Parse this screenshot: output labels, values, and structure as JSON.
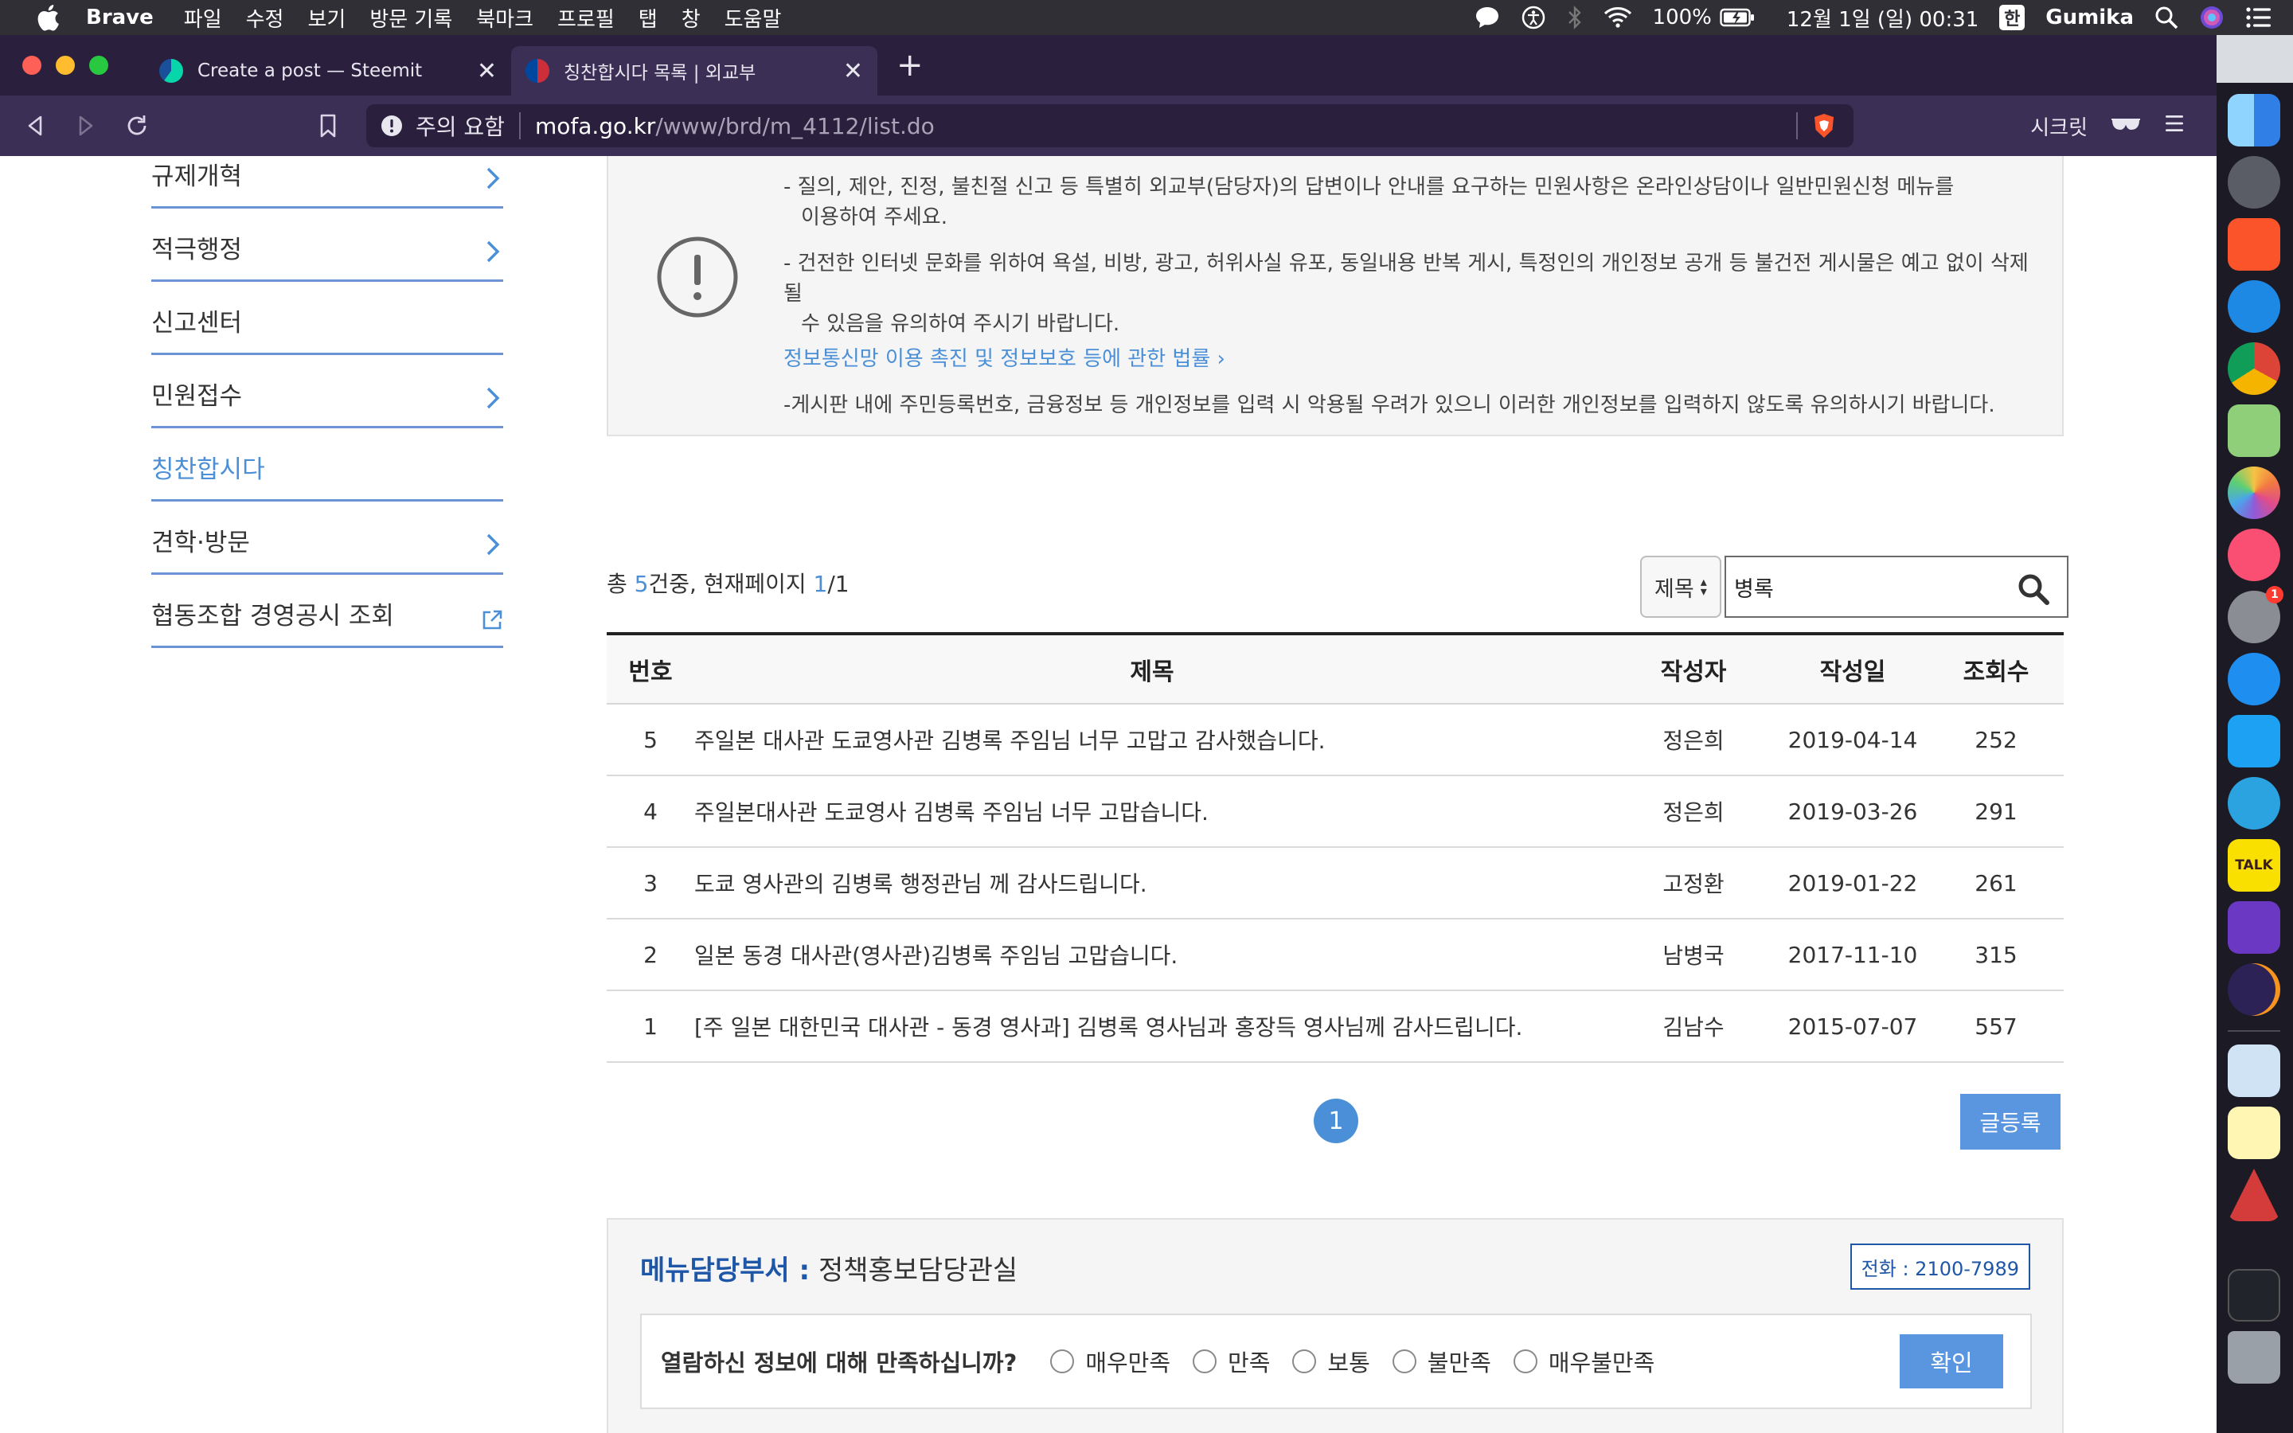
{
  "menubar": {
    "app_name": "Brave",
    "items": [
      "파일",
      "수정",
      "보기",
      "방문 기록",
      "북마크",
      "프로필",
      "탭",
      "창",
      "도움말"
    ],
    "battery": "100%",
    "datetime": "12월 1일 (일)  00:31",
    "input_method": "한",
    "user": "Gumika"
  },
  "browser": {
    "tabs": [
      {
        "title": "Create a post — Steemit",
        "close": "✕"
      },
      {
        "title": "칭찬합시다 목록 | 외교부",
        "close": "✕"
      }
    ],
    "new_tab": "+",
    "security_label": "주의 요함",
    "url_host": "mofa.go.kr",
    "url_path": "/www/brd/m_4112/list.do",
    "private_label": "시크릿"
  },
  "sidebar": {
    "items": [
      {
        "label": "규제개혁"
      },
      {
        "label": "적극행정"
      },
      {
        "label": "신고센터"
      },
      {
        "label": "민원접수"
      },
      {
        "label": "칭찬합시다"
      },
      {
        "label": "견학·방문"
      },
      {
        "label": "협동조합 경영공시 조회"
      }
    ]
  },
  "notice": {
    "line1a": "- 질의, 제안, 진정, 불친절 신고 등 특별히 외교부(담당자)의 답변이나 안내를 요구하는 민원사항은 온라인상담이나 일반민원신청 메뉴를",
    "line1b": "이용하여 주세요.",
    "line2a": "- 건전한 인터넷 문화를 위하여 욕설, 비방, 광고, 허위사실 유포, 동일내용 반복 게시, 특정인의 개인정보 공개 등 불건전 게시물은 예고 없이 삭제될",
    "line2b": "수 있음을 유의하여 주시기 바랍니다.",
    "link": "정보통신망 이용 촉진 및 정보보호 등에 관한 법률 ›",
    "line3": "-게시판 내에 주민등록번호, 금융정보 등 개인정보를 입력 시 악용될 우려가 있으니 이러한 개인정보를 입력하지 않도록 유의하시기 바랍니다."
  },
  "count": {
    "prefix": "총 ",
    "total": "5",
    "middle": "건중, 현재페이지 ",
    "page": "1",
    "suffix": "/1"
  },
  "search": {
    "field": "제목",
    "value": "병록"
  },
  "table": {
    "headers": [
      "번호",
      "제목",
      "작성자",
      "작성일",
      "조회수"
    ],
    "rows": [
      {
        "no": "5",
        "title": "주일본 대사관 도쿄영사관 김병록 주임님 너무 고맙고 감사했습니다.",
        "author": "정은희",
        "date": "2019-04-14",
        "views": "252"
      },
      {
        "no": "4",
        "title": "주일본대사관 도쿄영사 김병록 주임님 너무 고맙습니다.",
        "author": "정은희",
        "date": "2019-03-26",
        "views": "291"
      },
      {
        "no": "3",
        "title": "도쿄 영사관의 김병록 행정관님 께 감사드립니다.",
        "author": "고정환",
        "date": "2019-01-22",
        "views": "261"
      },
      {
        "no": "2",
        "title": "일본 동경 대사관(영사관)김병록 주임님 고맙습니다.",
        "author": "남병국",
        "date": "2017-11-10",
        "views": "315"
      },
      {
        "no": "1",
        "title": "[주 일본 대한민국 대사관 - 동경 영사과] 김병록 영사님과 홍장득 영사님께 감사드립니다.",
        "author": "김남수",
        "date": "2015-07-07",
        "views": "557"
      }
    ]
  },
  "pagination": {
    "current": "1"
  },
  "write_button": "글등록",
  "dept": {
    "label": "메뉴담당부서 :",
    "name": "정책홍보담당관실",
    "tel": "전화 : 2100-7989",
    "question": "열람하신 정보에 대해 만족하십니까?",
    "options": [
      "매우만족",
      "만족",
      "보통",
      "불만족",
      "매우불만족"
    ],
    "confirm": "확인"
  },
  "dock": {
    "kakao_label": "TALK",
    "badge": "1"
  },
  "colors": {
    "accent": "#4a8fd8",
    "dept_blue": "#1e56a8",
    "browser_chrome": "#3b2f55"
  }
}
